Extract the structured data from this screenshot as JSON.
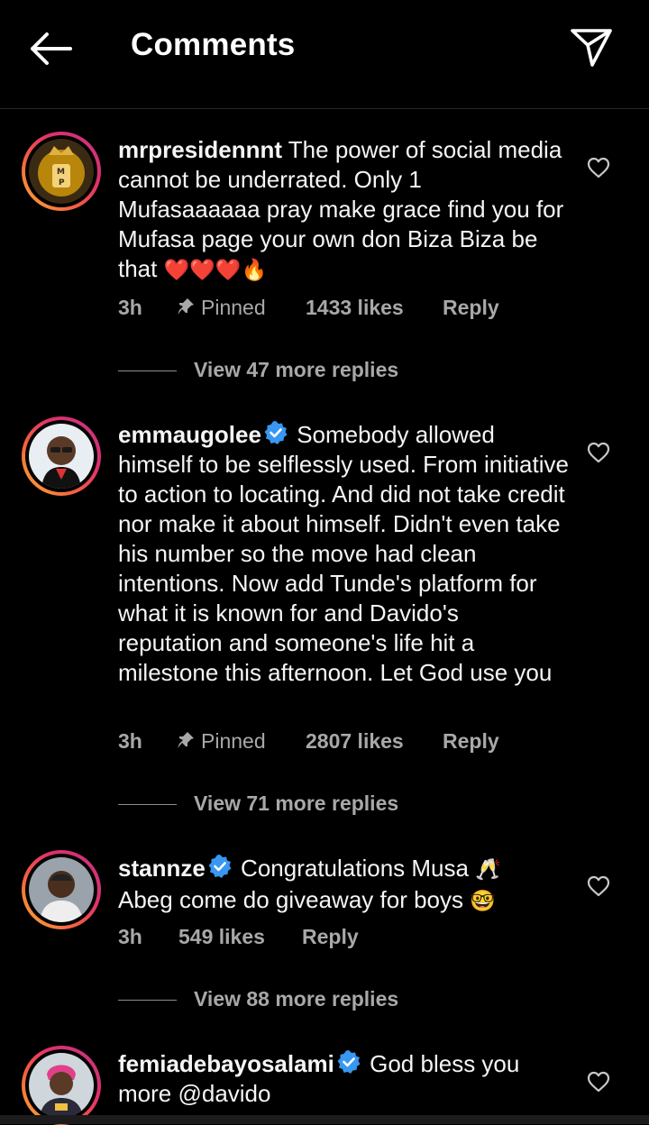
{
  "header": {
    "title": "Comments",
    "back_icon": "arrow-left-icon",
    "share_icon": "paper-plane-icon"
  },
  "colors": {
    "background": "#000000",
    "text": "#ffffff",
    "secondary_text": "#a8a8a8",
    "verified": "#3897f0",
    "divider": "#262626"
  },
  "comments": [
    {
      "username": "mrpresidennnt",
      "verified": false,
      "text": "The power of social media cannot be underrated. Only 1 Mufasaaaaaa pray make grace find you for Mufasa page your own don Biza Biza be that",
      "emojis": "❤️❤️❤️🔥",
      "time": "3h",
      "pinned_label": "Pinned",
      "likes": "1433 likes",
      "reply_label": "Reply",
      "view_replies": "View 47 more replies"
    },
    {
      "username": "emmaugolee",
      "verified": true,
      "text": "Somebody allowed himself to be selflessly used. From initiative to action to locating. And did not take credit nor make it about himself. Didn't even take his number so the move had clean intentions. Now add Tunde's platform for what it is known for and Davido's reputation and someone's life hit a milestone this afternoon. Let God use you",
      "time": "3h",
      "pinned_label": "Pinned",
      "likes": "2807 likes",
      "reply_label": "Reply",
      "view_replies": "View 71 more replies"
    },
    {
      "username": "stannze",
      "verified": true,
      "text_part1": "Congratulations Musa",
      "emoji1": "🥂",
      "text_part2": "Abeg come do giveaway for boys",
      "emoji2": "🤓",
      "time": "3h",
      "likes": "549 likes",
      "reply_label": "Reply",
      "view_replies": "View 88 more replies"
    },
    {
      "username": "femiadebayosalami",
      "verified": true,
      "text": "God bless you more @davido"
    }
  ]
}
